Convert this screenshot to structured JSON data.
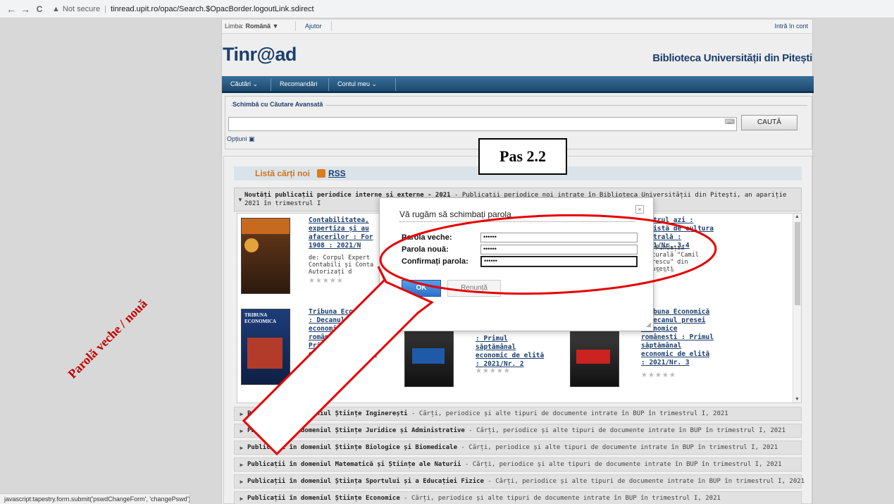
{
  "browser": {
    "back": "←",
    "forward": "→",
    "reload": "C",
    "warning_icon": "warning-triangle-icon",
    "not_secure": "Not secure",
    "separator": "|",
    "url": "tinread.upit.ro/opac/Search.$OpacBorder.logoutLink.sdirect"
  },
  "topbar": {
    "lang_label": "Limba: ",
    "lang_value": "Română ▼",
    "help": "Ajutor",
    "login": "Intră în cont"
  },
  "header": {
    "logo_part1": "Tinr",
    "logo_part2": "@",
    "logo_part3": "ad",
    "library": "Biblioteca Universității din Pitești"
  },
  "menu": {
    "items": [
      "Căutări ⌄",
      "Recomandări",
      "Contul meu ⌄"
    ]
  },
  "search": {
    "legend_prefix": "Schimbă cu ",
    "legend_link": "Căutare Avansată",
    "keyboard_icon": "keyboard-icon",
    "button": "CAUTĂ",
    "options": "Opțiuni ▣"
  },
  "list": {
    "title": "Listă cărți noi",
    "rss_icon": "rss-icon",
    "rss": "RSS",
    "section1_title": "Noutăți publicații periodice interne și externe - 2021",
    "section1_rest": " - Publicații periodice noi intrate în Biblioteca Universității din Pitești, an apariție 2021 în trimestrul I",
    "items": [
      {
        "title": "Contabilitatea, expertiza și au afacerilor : For 1908 : 2021/N",
        "meta": "de: Corpul Expert Contabili și Conta Autorizați d",
        "stars": "★★★★★"
      },
      {
        "title": "Teatrul azi : Revistă de cultura teatrală : 2021/Nr. 3-4",
        "meta": "de: Fundația Culturală \"Camil Petrescu\" din București",
        "stars": "★★★★★"
      },
      {
        "title": "Tribuna Economică : Decanul presei economice românești : Primul săptămânal economic de elită : 2021/Nr. 1",
        "meta": "",
        "stars": "★★★★★"
      },
      {
        "title": ": Primul săptămânal economic de elită : 2021/Nr. 2",
        "meta": "",
        "stars": "★★★★★"
      },
      {
        "title": "Tribuna Economică : Decanul presei economice românești : Primul săptămânal economic de elită : 2021/Nr. 3",
        "meta": "",
        "stars": "★★★★★"
      }
    ],
    "sections": [
      {
        "title": "Publicații în domeniul Științe Inginerești",
        "rest": " - Cărți, periodice și alte tipuri de documente intrate în BUP în trimestrul I, 2021"
      },
      {
        "title": "Publicații în domeniul Științe Juridice și Administrative",
        "rest": " - Cărți, periodice și alte tipuri de documente intrate în BUP în trimestrul I, 2021"
      },
      {
        "title": "Publicații în domeniul Științe Biologice și Biomedicale",
        "rest": " - Cărți, periodice și alte tipuri de documente intrate în BUP în trimestrul I, 2021"
      },
      {
        "title": "Publicații în domeniul Matematică și Științe ale Naturii",
        "rest": " - Cărți, periodice și alte tipuri de documente intrate în BUP în trimestrul I, 2021"
      },
      {
        "title": "Publicații în domeniul Știința Sportului și a Educației Fizice",
        "rest": " - Cărți, periodice și alte tipuri de documente intrate în BUP în trimestrul I, 2021"
      },
      {
        "title": "Publicații în domeniul Științe Economice",
        "rest": " - Cărți, periodice și alte tipuri de documente intrate în BUP în trimestrul I, 2021"
      }
    ]
  },
  "dialog": {
    "title": "Vă rugăm să schimbați parola",
    "close_icon": "close-icon",
    "old_label": "Parola veche:",
    "new_label": "Parola nouă:",
    "confirm_label": "Confirmați parola:",
    "old_value": "••••••",
    "new_value": "••••••",
    "confirm_value": "••••••",
    "ok": "OK",
    "cancel": "Renunță"
  },
  "annotations": {
    "step": "Pas 2.2",
    "arrow_text": "Parolă veche / nouă",
    "highlight_color": "#e60000"
  },
  "status": "javascript:tapestry.form.submit('pswdChangeForm', 'changePswd');"
}
